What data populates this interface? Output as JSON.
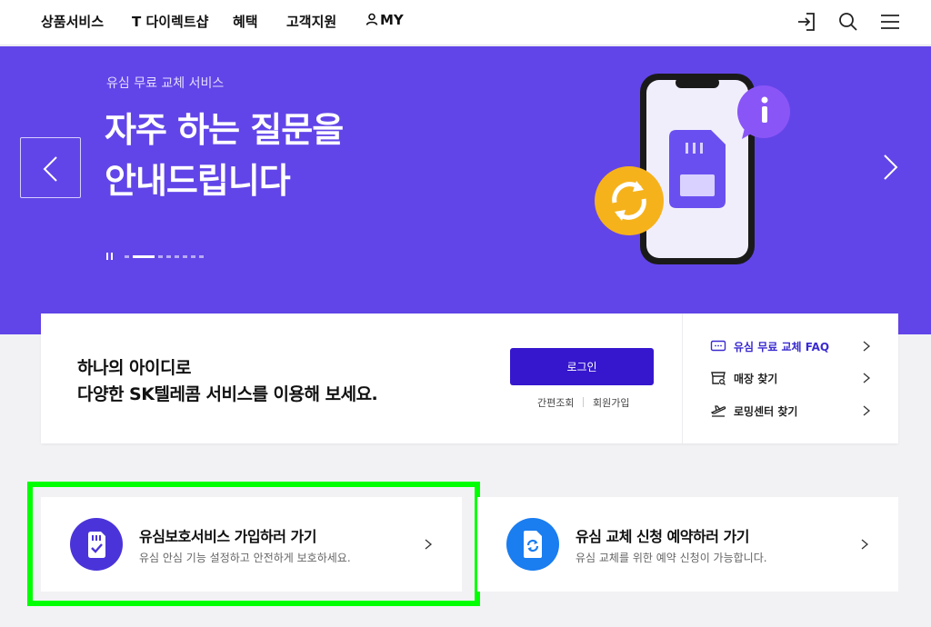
{
  "nav": {
    "items": [
      "상품서비스",
      "T 다이렉트샵",
      "혜택",
      "고객지원",
      "MY"
    ],
    "icons": [
      "login-icon",
      "search-icon",
      "menu-icon"
    ]
  },
  "hero": {
    "subtitle": "유심 무료 교체 서비스",
    "title_line1": "자주 하는 질문을",
    "title_line2": "안내드립니다",
    "slide_count": 8,
    "active_slide": 2,
    "accent": "#6245e8"
  },
  "login": {
    "message_line1": "하나의 아이디로",
    "message_line2": "다양한 SK텔레콤 서비스를 이용해 보세요.",
    "button": "로그인",
    "link_easy": "간편조회",
    "link_join": "회원가입",
    "button_color": "#3617ce"
  },
  "quick_links": [
    {
      "label": "유심 무료 교체 FAQ",
      "icon": "faq-icon"
    },
    {
      "label": "매장 찾기",
      "icon": "store-icon"
    },
    {
      "label": "로밍센터 찾기",
      "icon": "airplane-icon"
    }
  ],
  "services": [
    {
      "title": "유심보호서비스 가입하러 가기",
      "desc": "유심 안심 기능 설정하고 안전하게 보호하세요.",
      "icon": "sim-check-icon",
      "color": "#4a34d9"
    },
    {
      "title": "유심 교체 신청 예약하러 가기",
      "desc": "유심 교체를 위한 예약 신청이 가능합니다.",
      "icon": "refresh-doc-icon",
      "color": "#1a7df0"
    }
  ]
}
